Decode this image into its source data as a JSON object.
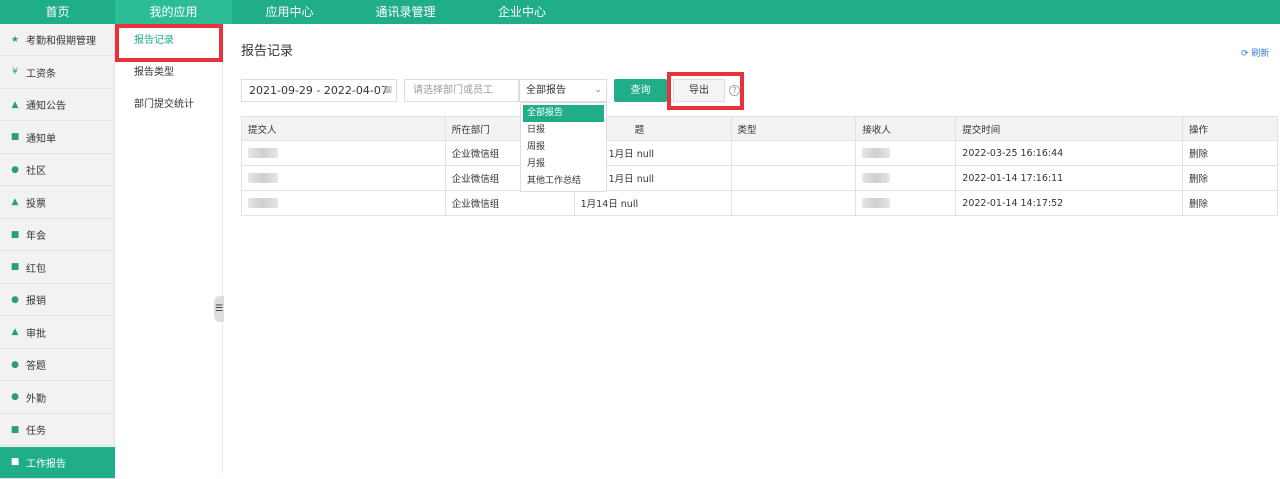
{
  "topnav": {
    "tabs": [
      {
        "label": "首页",
        "width": 115,
        "active": false
      },
      {
        "label": "我的应用",
        "width": 117,
        "active": true
      },
      {
        "label": "应用中心",
        "width": 115,
        "active": false
      },
      {
        "label": "通讯录管理",
        "width": 117,
        "active": false
      },
      {
        "label": "企业中心",
        "width": 116,
        "active": false
      }
    ]
  },
  "leftbar": {
    "items": [
      {
        "label": "考勤和假期管理",
        "icon": "★"
      },
      {
        "label": "工资条",
        "icon": "¥"
      },
      {
        "label": "通知公告",
        "icon": "▲"
      },
      {
        "label": "通知单",
        "icon": "■"
      },
      {
        "label": "社区",
        "icon": "●"
      },
      {
        "label": "投票",
        "icon": "▲"
      },
      {
        "label": "年会",
        "icon": "■"
      },
      {
        "label": "红包",
        "icon": "■"
      },
      {
        "label": "报销",
        "icon": "●"
      },
      {
        "label": "审批",
        "icon": "▲"
      },
      {
        "label": "答题",
        "icon": "●"
      },
      {
        "label": "外勤",
        "icon": "●"
      },
      {
        "label": "任务",
        "icon": "■"
      },
      {
        "label": "工作报告",
        "icon": "■",
        "active": true
      }
    ]
  },
  "subbar": {
    "items": [
      {
        "label": "报告记录",
        "active": true
      },
      {
        "label": "报告类型",
        "active": false
      },
      {
        "label": "部门提交统计",
        "active": false
      }
    ]
  },
  "main": {
    "title": "报告记录",
    "refresh": "刷新",
    "date_range": "2021-09-29 - 2022-04-07",
    "search_placeholder": "请选择部门或员工",
    "select_value": "全部报告",
    "dropdown_options": [
      "全部报告",
      "日报",
      "周报",
      "月报",
      "其他工作总结"
    ],
    "query_label": "查询",
    "export_label": "导出",
    "help_icon": "?"
  },
  "table": {
    "headers": [
      "提交人",
      "所在部门",
      "题",
      "类型",
      "接收人",
      "提交时间",
      "操作"
    ],
    "rows": [
      {
        "dept": "企业微信组",
        "title": "1月日 null",
        "type": "",
        "time": "2022-03-25 16:16:44",
        "op": "删除"
      },
      {
        "dept": "企业微信组",
        "title": "1月日 null",
        "type": "",
        "time": "2022-01-14 17:16:11",
        "op": "删除"
      },
      {
        "dept": "企业微信组",
        "title": "1月14日 null",
        "type": "",
        "time": "2022-01-14 14:17:52",
        "op": "删除"
      }
    ]
  },
  "colors": {
    "accent": "#1fae88",
    "highlight": "#e8333c",
    "link": "#3a7bd5"
  }
}
